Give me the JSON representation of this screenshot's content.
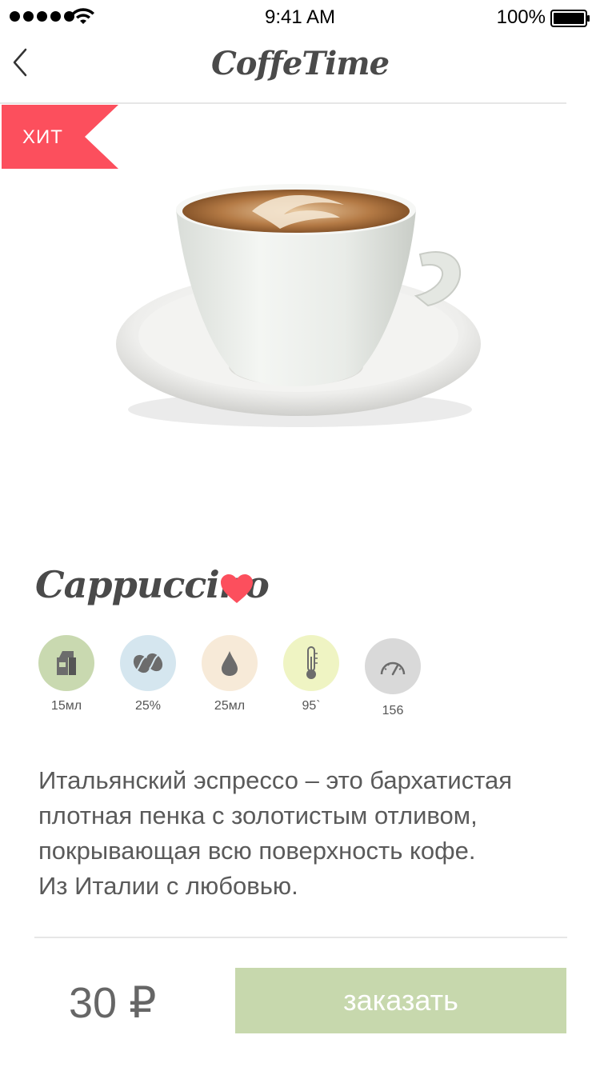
{
  "status_bar": {
    "time": "9:41 AM",
    "battery_percent": "100%"
  },
  "nav": {
    "title": "CoffeTime",
    "back_icon": "chevron-left-icon"
  },
  "badge": {
    "label": "ХИТ",
    "color": "#fc4f5d"
  },
  "product": {
    "name": "Cappuccino",
    "favorite": true,
    "stats": [
      {
        "icon": "milk-carton-icon",
        "value": "15мл",
        "color": "#c9d9b0"
      },
      {
        "icon": "coffee-beans-icon",
        "value": "25%",
        "color": "#d5e6ef"
      },
      {
        "icon": "water-drop-icon",
        "value": "25мл",
        "color": "#f7ead8"
      },
      {
        "icon": "thermometer-icon",
        "value": "95`",
        "color": "#eff4c3"
      },
      {
        "icon": "speedometer-icon",
        "value": "156",
        "color": "#d9d9d9"
      }
    ],
    "description_lines": [
      "Итальянский эспрессо – это бархатистая",
      "плотная пенка с золотистым отливом,",
      "покрывающая всю поверхность кофе.",
      "Из Италии с любовью."
    ]
  },
  "footer": {
    "price": "30 ₽",
    "order_label": "заказать",
    "accent": "#c7d8ad"
  }
}
